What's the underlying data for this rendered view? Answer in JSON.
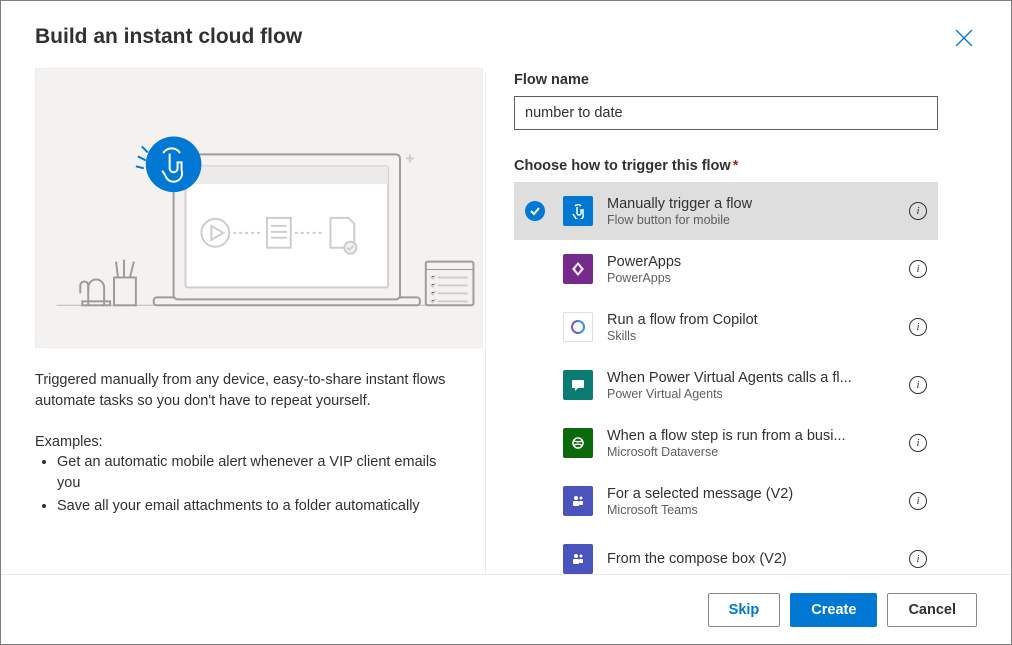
{
  "title": "Build an instant cloud flow",
  "left": {
    "description": "Triggered manually from any device, easy-to-share instant flows automate tasks so you don't have to repeat yourself.",
    "examples_label": "Examples:",
    "examples": [
      "Get an automatic mobile alert whenever a VIP client emails you",
      "Save all your email attachments to a folder automatically"
    ]
  },
  "right": {
    "flow_name_label": "Flow name",
    "flow_name_value": "number to date",
    "trigger_label": "Choose how to trigger this flow",
    "triggers": [
      {
        "title": "Manually trigger a flow",
        "subtitle": "Flow button for mobile",
        "icon": "touch-icon",
        "bg": "ic-blue",
        "selected": true
      },
      {
        "title": "PowerApps",
        "subtitle": "PowerApps",
        "icon": "powerapps-icon",
        "bg": "ic-purple",
        "selected": false
      },
      {
        "title": "Run a flow from Copilot",
        "subtitle": "Skills",
        "icon": "copilot-icon",
        "bg": "ic-white",
        "selected": false
      },
      {
        "title": "When Power Virtual Agents calls a fl...",
        "subtitle": "Power Virtual Agents",
        "icon": "pva-icon",
        "bg": "ic-teal",
        "selected": false
      },
      {
        "title": "When a flow step is run from a busi...",
        "subtitle": "Microsoft Dataverse",
        "icon": "dataverse-icon",
        "bg": "ic-green",
        "selected": false
      },
      {
        "title": "For a selected message (V2)",
        "subtitle": "Microsoft Teams",
        "icon": "teams-icon",
        "bg": "ic-indigo",
        "selected": false
      },
      {
        "title": "From the compose box (V2)",
        "subtitle": "",
        "icon": "teams-icon",
        "bg": "ic-indigo",
        "selected": false
      }
    ]
  },
  "footer": {
    "skip": "Skip",
    "create": "Create",
    "cancel": "Cancel"
  }
}
